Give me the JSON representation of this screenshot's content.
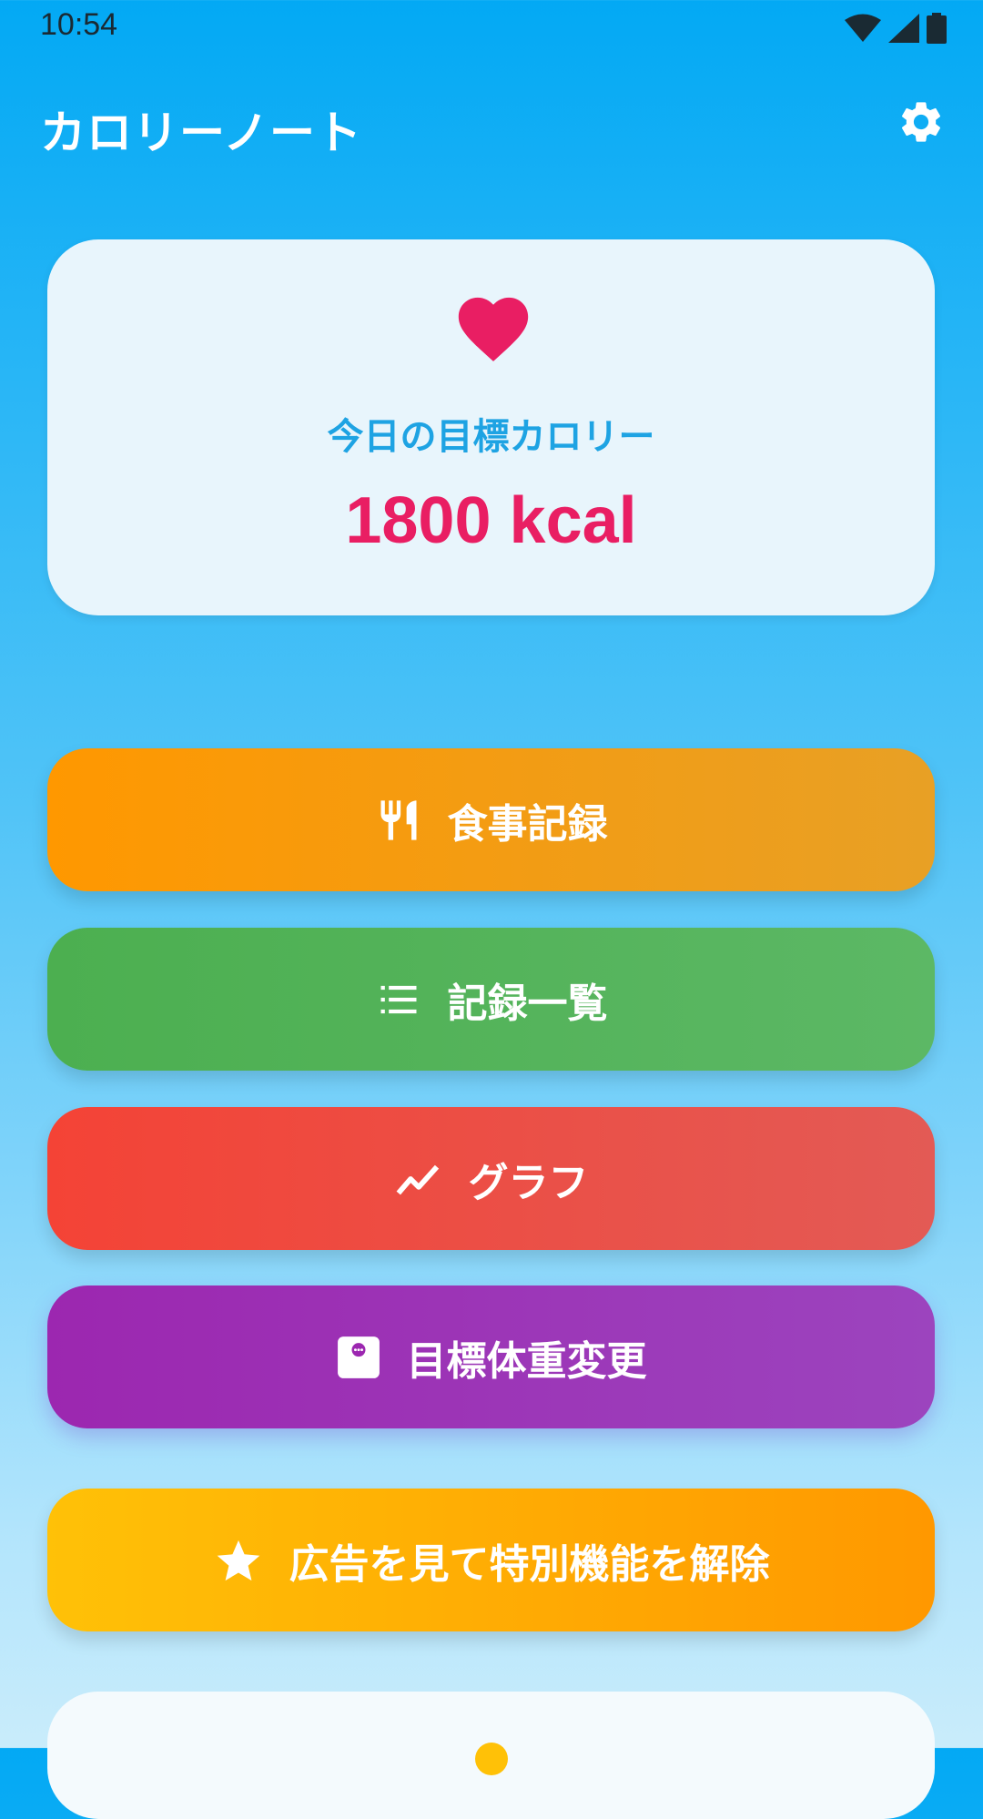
{
  "status_bar": {
    "time": "10:54",
    "icons": [
      "wifi-icon",
      "cellular-signal-icon",
      "battery-icon"
    ]
  },
  "app_bar": {
    "title": "カロリーノート",
    "settings_icon": "gear-icon"
  },
  "goal_card": {
    "icon": "heart-icon",
    "label": "今日の目標カロリー",
    "value": "1800 kcal"
  },
  "menu": {
    "meal_record": {
      "label": "食事記録",
      "icon": "fork-knife-icon",
      "color": "#FF9800"
    },
    "record_list": {
      "label": "記録一覧",
      "icon": "list-icon",
      "color": "#4CAF50"
    },
    "graph": {
      "label": "グラフ",
      "icon": "trending-up-icon",
      "color": "#F44336"
    },
    "target_weight": {
      "label": "目標体重変更",
      "icon": "scale-icon",
      "color": "#9C27B0"
    },
    "unlock_ad": {
      "label": "広告を見て特別機能を解除",
      "icon": "star-icon",
      "color": "#FFC107"
    }
  },
  "colors": {
    "background_top": "#03A9F4",
    "background_bottom": "#C9ECFB",
    "accent_pink": "#E91E63",
    "accent_blue": "#1EA3E3"
  }
}
